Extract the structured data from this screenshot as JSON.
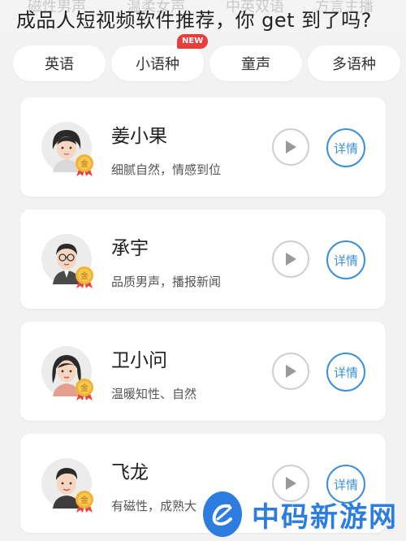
{
  "header": {
    "headline": "成品人短视频软件推荐，你 get 到了吗?",
    "ghost_labels": [
      "磁性男声",
      "温柔女声",
      "中英双语",
      "方言主播"
    ]
  },
  "tabs": [
    {
      "label": "英语"
    },
    {
      "label": "小语种",
      "badge": "NEW"
    },
    {
      "label": "童声"
    },
    {
      "label": "多语种"
    }
  ],
  "voices": [
    {
      "name": "姜小果",
      "desc": "细腻自然，情感到位",
      "medal": "金",
      "play_icon": "play-icon",
      "detail_label": "详情"
    },
    {
      "name": "承宇",
      "desc": "品质男声，播报新闻",
      "medal": "金",
      "play_icon": "play-icon",
      "detail_label": "详情"
    },
    {
      "name": "卫小问",
      "desc": "温暖知性、自然",
      "medal": "金",
      "play_icon": "play-icon",
      "detail_label": "详情"
    },
    {
      "name": "飞龙",
      "desc": "有磁性，成熟大",
      "medal": "金",
      "play_icon": "play-icon",
      "detail_label": "详情"
    }
  ],
  "watermark": {
    "text": "中码新游网"
  },
  "colors": {
    "accent": "#3d8fd6",
    "badge": "#e83d3d",
    "watermark": "#2d7de0"
  }
}
